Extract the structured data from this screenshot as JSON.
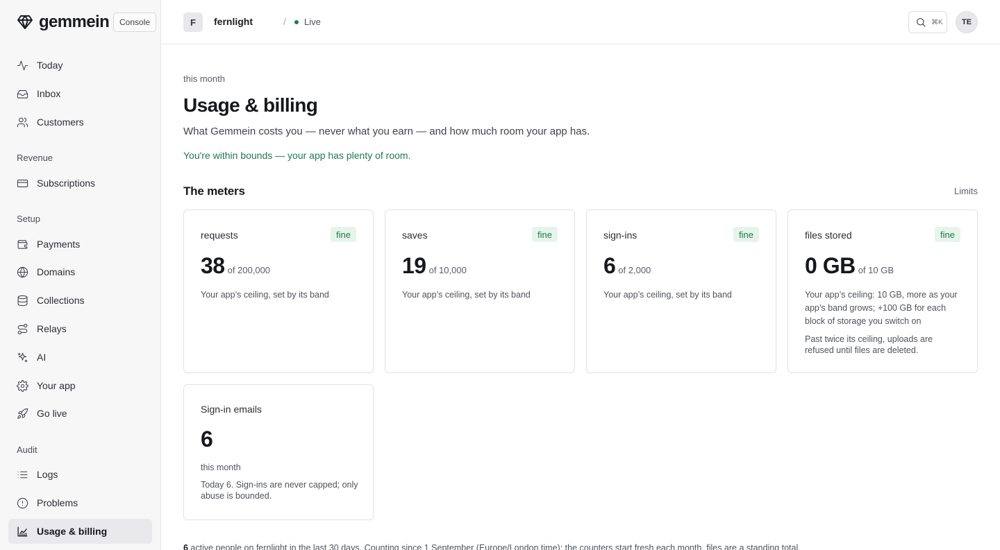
{
  "brand": {
    "name": "gemmein",
    "console_label": "Console"
  },
  "nav": {
    "today": "Today",
    "inbox": "Inbox",
    "customers": "Customers",
    "section_revenue": "Revenue",
    "subscriptions": "Subscriptions",
    "section_setup": "Setup",
    "payments": "Payments",
    "domains": "Domains",
    "collections": "Collections",
    "relays": "Relays",
    "ai": "AI",
    "your_app": "Your app",
    "go_live": "Go live",
    "section_audit": "Audit",
    "logs": "Logs",
    "problems": "Problems",
    "usage_billing": "Usage & billing"
  },
  "topbar": {
    "project_initial": "F",
    "project_name": "fernlight",
    "separator": "/",
    "env_label": "Live",
    "search_shortcut": "⌘K",
    "user_initials": "TE"
  },
  "page": {
    "eyebrow": "this month",
    "title": "Usage & billing",
    "subtitle": "What Gemmein costs you — never what you earn — and how much room your app has.",
    "status": "You're within bounds — your app has plenty of room.",
    "section_title": "The meters",
    "limits_link": "Limits"
  },
  "meters": [
    {
      "name": "requests",
      "badge": "fine",
      "value": "38",
      "of": "of 200,000",
      "note": "Your app’s ceiling, set by its band"
    },
    {
      "name": "saves",
      "badge": "fine",
      "value": "19",
      "of": "of 10,000",
      "note": "Your app’s ceiling, set by its band"
    },
    {
      "name": "sign-ins",
      "badge": "fine",
      "value": "6",
      "of": "of 2,000",
      "note": "Your app’s ceiling, set by its band"
    },
    {
      "name": "files stored",
      "badge": "fine",
      "value": "0 GB",
      "of": "of 10 GB",
      "note": "Your app’s ceiling: 10 GB, more as your app’s band grows; +100 GB for each block of storage you switch on",
      "note2": "Past twice its ceiling, uploads are refused until files are deleted."
    },
    {
      "name": "Sign-in emails",
      "value": "6",
      "period": "this month",
      "note": "Today 6. Sign-ins are never capped; only abuse is bounded."
    }
  ],
  "footer": {
    "count": "6",
    "text": " active people on fernlight in the last 30 days. Counting since 1 September (Europe/London time); the counters start fresh each month, files are a standing total."
  },
  "colors": {
    "accent_green": "#1f7a4d",
    "badge_bg": "#e6f4ec",
    "sidebar_bg": "#f7f7f8"
  }
}
